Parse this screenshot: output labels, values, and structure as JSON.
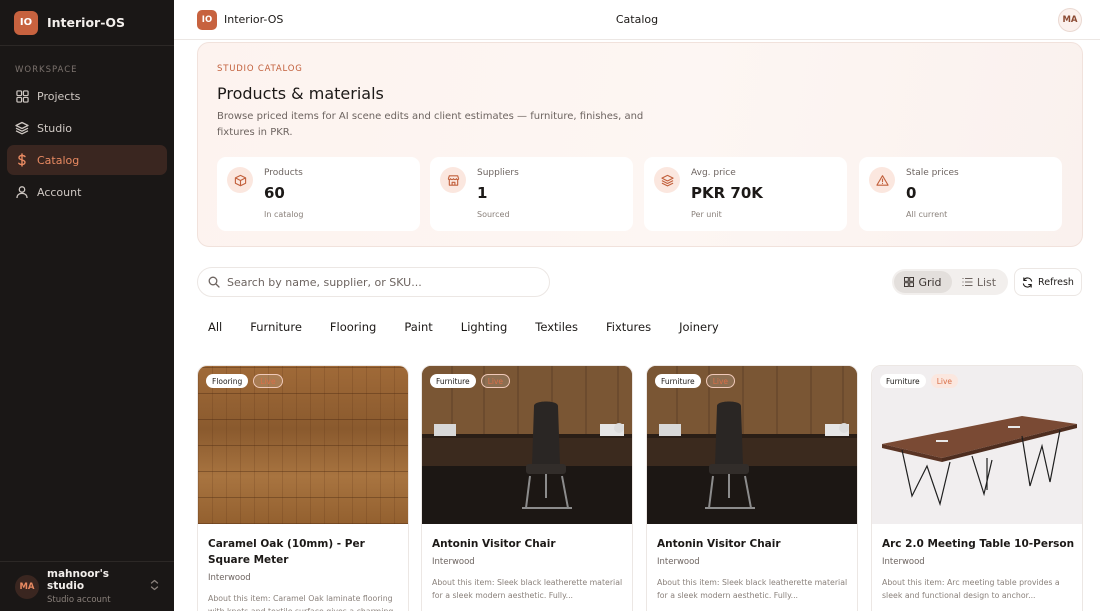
{
  "app": {
    "name": "Interior-OS",
    "initials": "IO"
  },
  "sidebar": {
    "section": "WORKSPACE",
    "items": [
      {
        "label": "Projects",
        "icon": "grid-icon"
      },
      {
        "label": "Studio",
        "icon": "layers-icon"
      },
      {
        "label": "Catalog",
        "icon": "dollar-icon",
        "active": true
      },
      {
        "label": "Account",
        "icon": "user-icon"
      }
    ],
    "user": {
      "initials": "MA",
      "name": "mahnoor's studio",
      "role": "Studio account"
    }
  },
  "topbar": {
    "app_name": "Interior-OS",
    "title": "Catalog",
    "avatar": "MA"
  },
  "hero": {
    "eyebrow": "STUDIO CATALOG",
    "title": "Products & materials",
    "description": "Browse priced items for AI scene edits and client estimates — furniture, finishes, and fixtures in PKR.",
    "stats": [
      {
        "label": "Products",
        "value": "60",
        "sub": "In catalog",
        "icon": "box-icon"
      },
      {
        "label": "Suppliers",
        "value": "1",
        "sub": "Sourced",
        "icon": "store-icon"
      },
      {
        "label": "Avg. price",
        "value": "PKR 70K",
        "sub": "Per unit",
        "icon": "layers-icon"
      },
      {
        "label": "Stale prices",
        "value": "0",
        "sub": "All current",
        "icon": "warning-icon"
      }
    ]
  },
  "search": {
    "placeholder": "Search by name, supplier, or SKU..."
  },
  "view_toggle": {
    "grid_label": "Grid",
    "list_label": "List",
    "selected": "Grid"
  },
  "refresh_label": "Refresh",
  "categories": [
    "All",
    "Furniture",
    "Flooring",
    "Paint",
    "Lighting",
    "Textiles",
    "Fixtures",
    "Joinery"
  ],
  "products": [
    {
      "category": "Flooring",
      "status": "Live",
      "title": "Caramel Oak (10mm) - Per Square Meter",
      "supplier": "Interwood",
      "about": "About this item: Caramel Oak laminate flooring with knots and textile surface gives a charming..."
    },
    {
      "category": "Furniture",
      "status": "Live",
      "title": "Antonin Visitor Chair",
      "supplier": "Interwood",
      "about": "About this item: Sleek black leatherette material for a sleek modern aesthetic. Fully..."
    },
    {
      "category": "Furniture",
      "status": "Live",
      "title": "Antonin Visitor Chair",
      "supplier": "Interwood",
      "about": "About this item: Sleek black leatherette material for a sleek modern aesthetic. Fully..."
    },
    {
      "category": "Furniture",
      "status": "Live",
      "title": "Arc 2.0 Meeting Table 10-Person",
      "supplier": "Interwood",
      "about": "About this item: Arc meeting table provides a sleek and functional design to anchor..."
    }
  ]
}
